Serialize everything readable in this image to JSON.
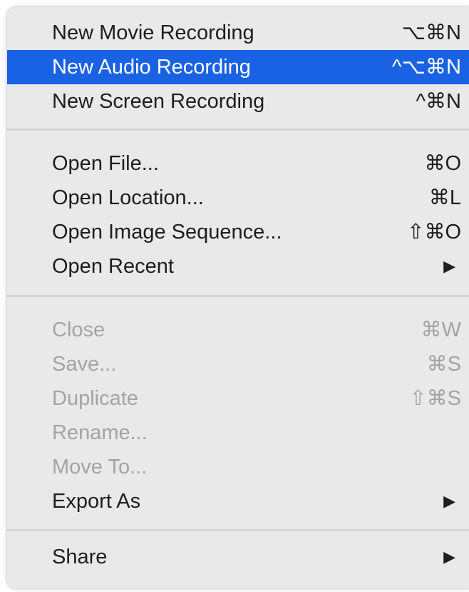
{
  "menu": {
    "groups": [
      {
        "items": [
          {
            "label": "New Movie Recording",
            "shortcut": "⌥⌘N",
            "enabled": true,
            "highlighted": false
          },
          {
            "label": "New Audio Recording",
            "shortcut": "^⌥⌘N",
            "enabled": true,
            "highlighted": true
          },
          {
            "label": "New Screen Recording",
            "shortcut": "^⌘N",
            "enabled": true,
            "highlighted": false
          }
        ]
      },
      {
        "items": [
          {
            "label": "Open File...",
            "shortcut": "⌘O",
            "enabled": true
          },
          {
            "label": "Open Location...",
            "shortcut": "⌘L",
            "enabled": true
          },
          {
            "label": "Open Image Sequence...",
            "shortcut": "⇧⌘O",
            "enabled": true
          },
          {
            "label": "Open Recent",
            "submenu_arrow": "▶",
            "enabled": true
          }
        ]
      },
      {
        "items": [
          {
            "label": "Close",
            "shortcut": "⌘W",
            "enabled": false
          },
          {
            "label": "Save...",
            "shortcut": "⌘S",
            "enabled": false
          },
          {
            "label": "Duplicate",
            "shortcut": "⇧⌘S",
            "enabled": false
          },
          {
            "label": "Rename...",
            "enabled": false
          },
          {
            "label": "Move To...",
            "enabled": false
          },
          {
            "label": "Export As",
            "submenu_arrow": "▶",
            "enabled": true
          }
        ]
      },
      {
        "items": [
          {
            "label": "Share",
            "submenu_arrow": "▶",
            "enabled": true
          }
        ]
      }
    ]
  },
  "colors": {
    "highlight": "#1a62e4",
    "background": "#e9e9e9",
    "disabled_text": "#a4a4a4",
    "separator": "#d4d4d4"
  }
}
